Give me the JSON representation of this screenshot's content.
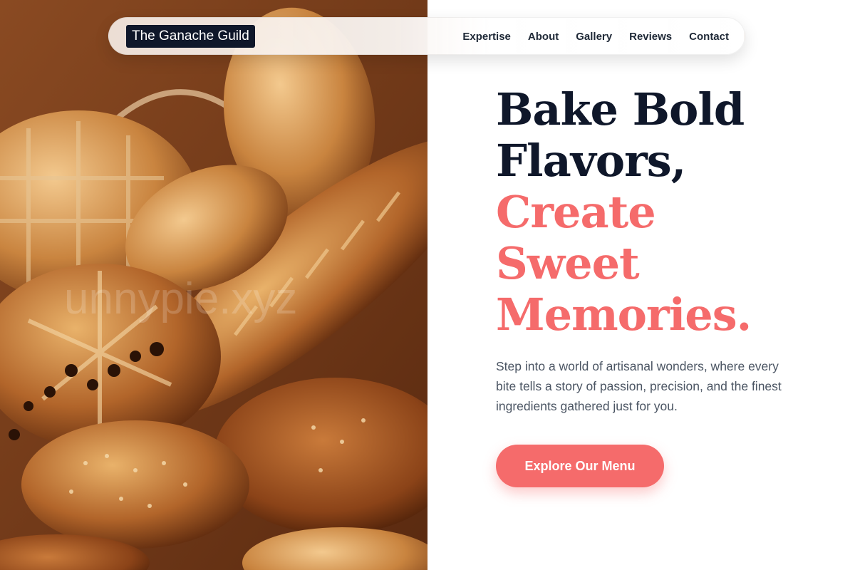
{
  "header": {
    "brand": "The Ganache Guild",
    "nav": [
      {
        "label": "Expertise"
      },
      {
        "label": "About"
      },
      {
        "label": "Gallery"
      },
      {
        "label": "Reviews"
      },
      {
        "label": "Contact"
      }
    ]
  },
  "hero": {
    "headline_lines": [
      "Bake Bold",
      "Flavors,",
      "Create",
      "Sweet",
      "Memories."
    ],
    "description": "Step into a world of artisanal wonders, where every bite tells a story of passion, precision, and the finest ingredients gathered just for you.",
    "cta_label": "Explore Our Menu",
    "image_watermark": "unnypie.xyz"
  },
  "colors": {
    "accent": "#f56b6b",
    "heading_dark": "#0f172a",
    "body_text": "#4b5563"
  }
}
